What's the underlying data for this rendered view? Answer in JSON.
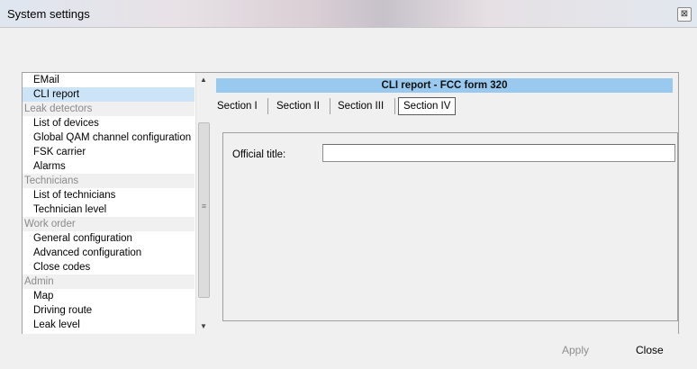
{
  "window": {
    "title": "System settings",
    "close_glyph": "⊠"
  },
  "sidebar": {
    "items": [
      {
        "type": "item",
        "label": "EMail"
      },
      {
        "type": "item",
        "label": "CLI report",
        "selected": true
      },
      {
        "type": "group",
        "label": "Leak detectors"
      },
      {
        "type": "item",
        "label": "List of devices"
      },
      {
        "type": "item",
        "label": "Global QAM channel configuration"
      },
      {
        "type": "item",
        "label": "FSK carrier"
      },
      {
        "type": "item",
        "label": "Alarms"
      },
      {
        "type": "group",
        "label": "Technicians"
      },
      {
        "type": "item",
        "label": "List of technicians"
      },
      {
        "type": "item",
        "label": "Technician level"
      },
      {
        "type": "group",
        "label": "Work order"
      },
      {
        "type": "item",
        "label": "General configuration"
      },
      {
        "type": "item",
        "label": "Advanced configuration"
      },
      {
        "type": "item",
        "label": "Close codes"
      },
      {
        "type": "group",
        "label": "Admin"
      },
      {
        "type": "item",
        "label": "Map"
      },
      {
        "type": "item",
        "label": "Driving route"
      },
      {
        "type": "item",
        "label": "Leak level"
      }
    ],
    "scroll_up_glyph": "▲",
    "scroll_down_glyph": "▼",
    "scroll_grip_glyph": "≡"
  },
  "content": {
    "header": "CLI report - FCC form 320",
    "tabs": [
      {
        "label": "Section I"
      },
      {
        "label": "Section II"
      },
      {
        "label": "Section III"
      },
      {
        "label": "Section IV",
        "active": true
      }
    ],
    "official_title_label": "Official title:",
    "official_title_value": ""
  },
  "footer": {
    "apply_label": "Apply",
    "close_label": "Close"
  },
  "colors": {
    "selected_item": "#cce4f7",
    "report_header": "#99c9ee",
    "group_text": "#8a8a8a",
    "disabled_button": "#8e8e8e"
  },
  "icons": {
    "close": "close-icon",
    "scroll_up": "scroll-up-arrow-icon",
    "scroll_down": "scroll-down-arrow-icon",
    "scroll_grip": "scroll-grip-icon"
  }
}
